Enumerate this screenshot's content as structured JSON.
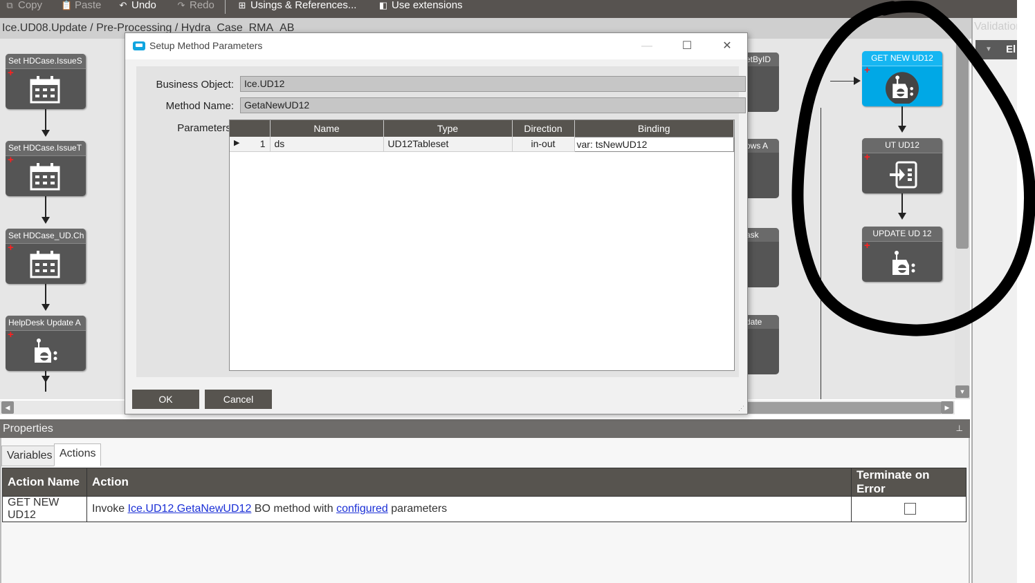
{
  "toolbar": {
    "copy": "Copy",
    "paste": "Paste",
    "undo": "Undo",
    "redo": "Redo",
    "usings": "Usings & References...",
    "extensions": "Use extensions"
  },
  "breadcrumb": "Ice.UD08.Update / Pre-Processing / Hydra_Case_RMA_AB",
  "canvas": {
    "left_nodes": [
      {
        "title": "Set HDCase.IssueS",
        "icon": "calendar-icon"
      },
      {
        "title": "Set HDCase.IssueT",
        "icon": "calendar-icon"
      },
      {
        "title": "Set HDCase_UD.Ch",
        "icon": "calendar-icon"
      },
      {
        "title": "HelpDesk Update A",
        "icon": "bo-method-icon"
      }
    ],
    "partial_nodes": [
      "etByID",
      "ows A",
      "ask",
      "date"
    ],
    "right_nodes": [
      {
        "title": "GET NEW UD12",
        "icon": "bo-method-icon",
        "selected": true
      },
      {
        "title": "UT UD12",
        "icon": "exit-icon",
        "selected": false
      },
      {
        "title": "UPDATE UD 12",
        "icon": "bo-method-icon",
        "selected": false
      }
    ]
  },
  "validation": {
    "header": "Validation",
    "column": "El"
  },
  "dialog": {
    "title": "Setup Method Parameters",
    "business_object_label": "Business Object:",
    "business_object_value": "Ice.UD12",
    "method_name_label": "Method Name:",
    "method_name_value": "GetaNewUD12",
    "parameters_label": "Parameters:",
    "grid_headers": [
      "",
      "Name",
      "Type",
      "Direction",
      "Binding"
    ],
    "grid_rows": [
      {
        "index": "1",
        "name": "ds",
        "type": "UD12Tableset",
        "direction": "in-out",
        "binding": "var: tsNewUD12"
      }
    ],
    "ok": "OK",
    "cancel": "Cancel"
  },
  "properties": {
    "header": "Properties",
    "tabs": [
      "Variables",
      "Actions"
    ],
    "active_tab": "Actions",
    "columns": [
      "Action Name",
      "Action",
      "Terminate on Error"
    ],
    "rows": [
      {
        "name": "GET NEW UD12",
        "action_prefix": "Invoke",
        "action_link1": "Ice.UD12.GetaNewUD12",
        "action_middle": "BO method with",
        "action_link2": "configured",
        "action_suffix": "parameters",
        "terminate_on_error": false
      }
    ]
  },
  "colors": {
    "toolbar": "#575350",
    "canvas": "#e6e6e6",
    "node": "#555555",
    "node_selected": "#00a8e6",
    "annotation": "#000000"
  }
}
